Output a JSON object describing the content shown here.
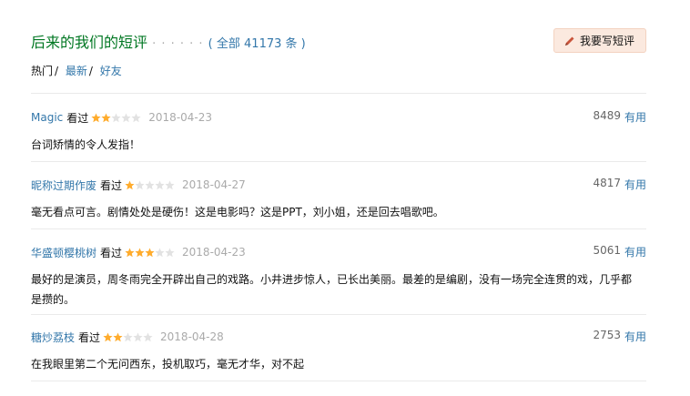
{
  "header": {
    "title": "后来的我们的短评",
    "dots": "· · · · · ·",
    "total_open": "( ",
    "total_label": "全部 41173 条",
    "total_close": " )",
    "write_button": "我要写短评"
  },
  "tabs": {
    "hot": "热门",
    "latest": "最新",
    "friends": "好友",
    "sep": "/"
  },
  "comments": [
    {
      "user": "Magic",
      "status": "看过",
      "rating": 2,
      "date": "2018-04-23",
      "votes": "8489",
      "useful": "有用",
      "content": "台词矫情的令人发指！"
    },
    {
      "user": "昵称过期作废",
      "status": "看过",
      "rating": 1,
      "date": "2018-04-27",
      "votes": "4817",
      "useful": "有用",
      "content": "毫无看点可言。剧情处处是硬伤！这是电影吗？这是PPT，刘小姐，还是回去唱歌吧。"
    },
    {
      "user": "华盛顿樱桃树",
      "status": "看过",
      "rating": 3,
      "date": "2018-04-23",
      "votes": "5061",
      "useful": "有用",
      "content": "最好的是演员，周冬雨完全开辟出自己的戏路。小井进步惊人，已长出美丽。最差的是编剧，没有一场完全连贯的戏，几乎都是攒的。"
    },
    {
      "user": "糖炒荔枝",
      "status": "看过",
      "rating": 2,
      "date": "2018-04-28",
      "votes": "2753",
      "useful": "有用",
      "content": "在我眼里第二个无问西东，投机取巧，毫无才华，对不起"
    }
  ],
  "colors": {
    "star_on": "#ffac2d",
    "star_off": "#e2e2e2",
    "link": "#3377aa",
    "title": "#007722"
  }
}
